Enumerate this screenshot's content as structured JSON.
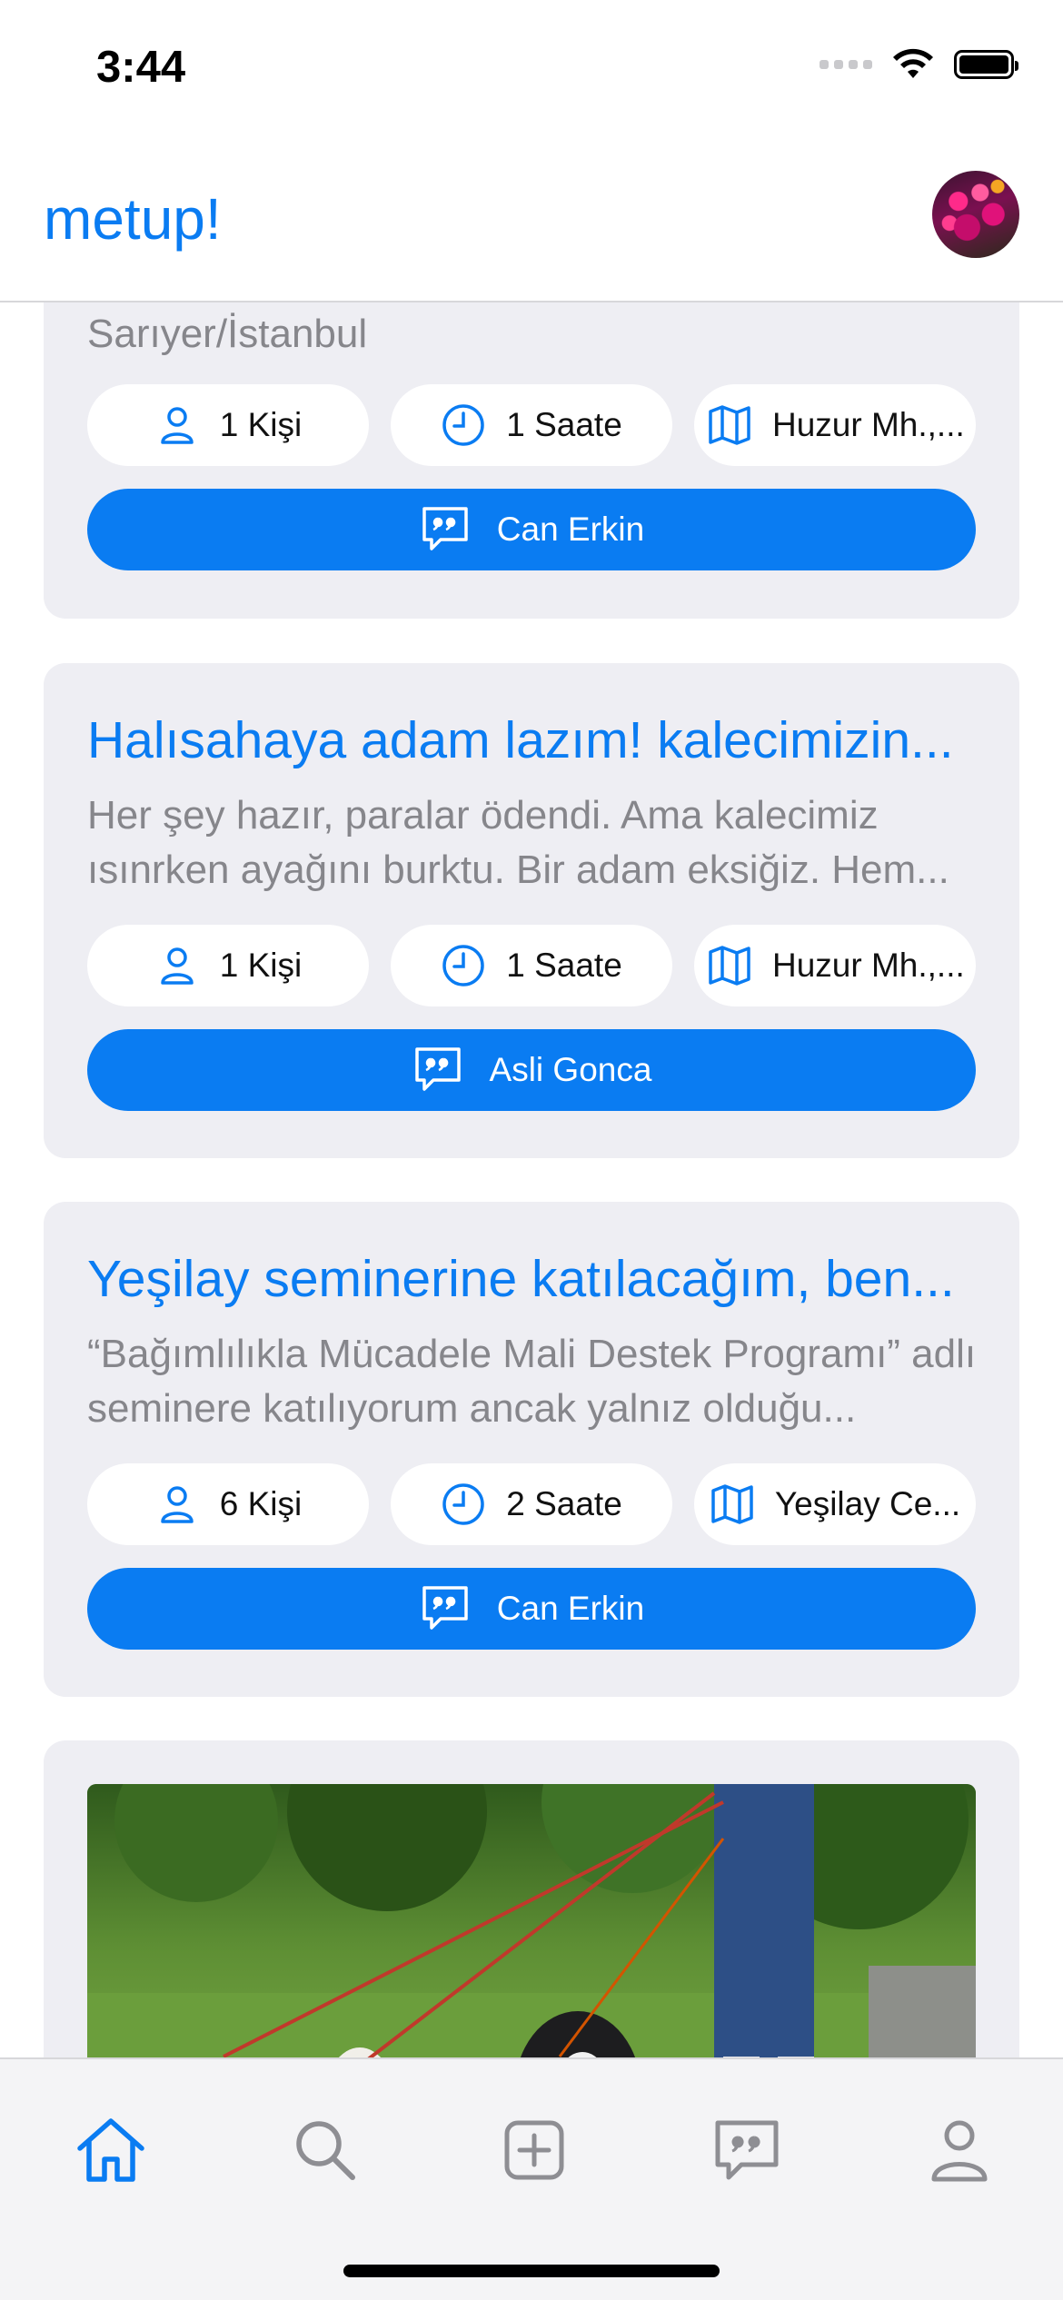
{
  "status_bar": {
    "time": "3:44"
  },
  "header": {
    "logo": "metup!"
  },
  "colors": {
    "accent": "#0a7cf2",
    "card_bg": "#eeeef3",
    "muted_text": "#86868b"
  },
  "cards": [
    {
      "title": "",
      "description": "Sarıyer/İstanbul",
      "people": "1 Kişi",
      "time": "1 Saate",
      "location": "Huzur Mh.,...",
      "host": "Can Erkin"
    },
    {
      "title": "Halısahaya adam lazım! kalecimizin...",
      "description": "Her şey hazır, paralar ödendi. Ama kalecimiz ısınrken ayağını burktu. Bir adam eksiğiz. Hem...",
      "people": "1 Kişi",
      "time": "1 Saate",
      "location": "Huzur Mh.,...",
      "host": "Asli Gonca"
    },
    {
      "title": "Yeşilay seminerine katılacağım, ben...",
      "description": "“Bağımlılıkla Mücadele Mali Destek Programı” adlı seminere katılıyorum ancak yalnız olduğu...",
      "people": "6 Kişi",
      "time": "2 Saate",
      "location": "Yeşilay Ce...",
      "host": "Can Erkin"
    }
  ],
  "icons": {
    "people": "person-icon",
    "time": "clock-icon",
    "location": "map-icon",
    "chat": "chat-bubble-quote-icon"
  },
  "tabs": [
    {
      "name": "home",
      "icon": "house-icon",
      "active": true
    },
    {
      "name": "search",
      "icon": "magnifying-glass-icon",
      "active": false
    },
    {
      "name": "create",
      "icon": "plus-square-icon",
      "active": false
    },
    {
      "name": "messages",
      "icon": "chat-bubble-quote-icon",
      "active": false
    },
    {
      "name": "profile",
      "icon": "person-icon",
      "active": false
    }
  ]
}
